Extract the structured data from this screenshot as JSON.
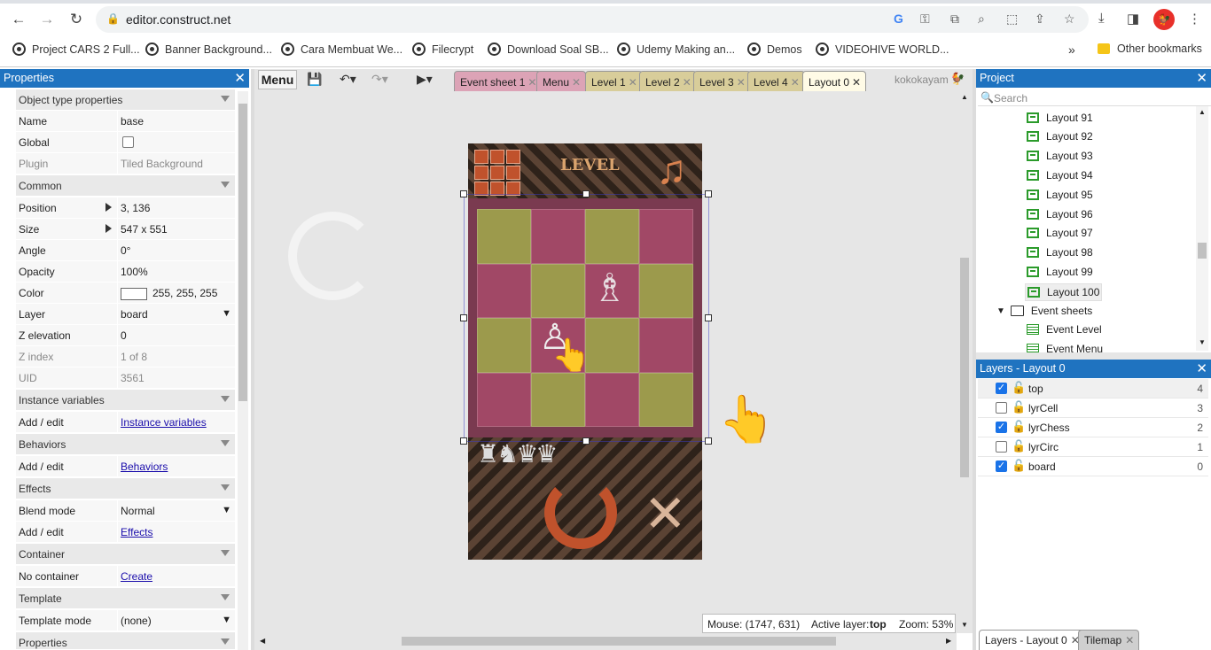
{
  "browser": {
    "url": "editor.construct.net",
    "bookmarks": [
      "Project CARS 2 Full...",
      "Banner Background...",
      "Cara Membuat We...",
      "Filecrypt",
      "Download Soal SB...",
      "Udemy Making an...",
      "Demos",
      "VIDEOHIVE WORLD..."
    ],
    "overflow": "»",
    "other_bookmarks": "Other bookmarks"
  },
  "properties": {
    "title": "Properties",
    "rows": {
      "obj_type": "Object type properties",
      "name_k": "Name",
      "name_v": "base",
      "global_k": "Global",
      "plugin_k": "Plugin",
      "plugin_v": "Tiled Background",
      "common": "Common",
      "position_k": "Position",
      "position_v": "3, 136",
      "size_k": "Size",
      "size_v": "547 x 551",
      "angle_k": "Angle",
      "angle_v": "0°",
      "opacity_k": "Opacity",
      "opacity_v": "100%",
      "color_k": "Color",
      "color_v": "255, 255, 255",
      "layer_k": "Layer",
      "layer_v": "board",
      "zelev_k": "Z elevation",
      "zelev_v": "0",
      "zindex_k": "Z index",
      "zindex_v": "1 of 8",
      "uid_k": "UID",
      "uid_v": "3561",
      "instvars": "Instance variables",
      "addedit1_k": "Add / edit",
      "addedit1_v": "Instance variables",
      "behaviors": "Behaviors",
      "addedit2_k": "Add / edit",
      "addedit2_v": "Behaviors",
      "effects": "Effects",
      "blend_k": "Blend mode",
      "blend_v": "Normal",
      "addedit3_k": "Add / edit",
      "addedit3_v": "Effects",
      "container": "Container",
      "nocont_k": "No container",
      "nocont_v": "Create",
      "template": "Template",
      "tmode_k": "Template mode",
      "tmode_v": "(none)",
      "props": "Properties"
    }
  },
  "toolbar": {
    "menu": "Menu",
    "tabs": [
      "Event sheet 1",
      "Menu",
      "Level 1",
      "Level 2",
      "Level 3",
      "Level 4",
      "Layout 0"
    ],
    "close": "✕",
    "user": "kokokayam"
  },
  "game": {
    "level_label": "LEVEL"
  },
  "status": {
    "mouse": "Mouse: (1747, 631)",
    "active_layer_label": "Active layer:",
    "active_layer": "top",
    "zoom": "Zoom: 53%"
  },
  "project": {
    "title": "Project",
    "search_placeholder": "Search",
    "layouts": [
      "Layout 91",
      "Layout 92",
      "Layout 93",
      "Layout 94",
      "Layout 95",
      "Layout 96",
      "Layout 97",
      "Layout 98",
      "Layout 99",
      "Layout 100"
    ],
    "event_sheets": "Event sheets",
    "events": [
      "Event Level",
      "Event Menu"
    ]
  },
  "layers": {
    "title": "Layers - Layout 0",
    "items": [
      {
        "name": "top",
        "num": "4",
        "checked": true
      },
      {
        "name": "lyrCell",
        "num": "3",
        "checked": false
      },
      {
        "name": "lyrChess",
        "num": "2",
        "checked": true
      },
      {
        "name": "lyrCirc",
        "num": "1",
        "checked": false
      },
      {
        "name": "board",
        "num": "0",
        "checked": true
      }
    ]
  },
  "bottom_tabs": [
    "Layers - Layout 0",
    "Tilemap"
  ]
}
